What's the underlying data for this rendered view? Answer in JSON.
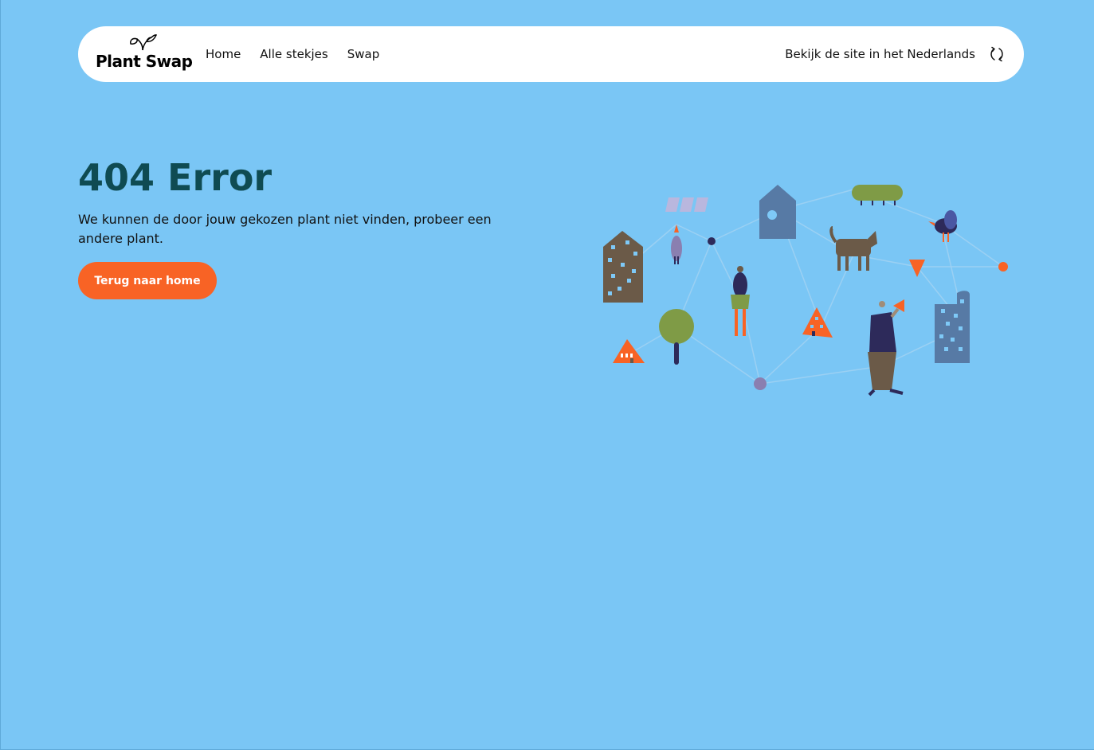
{
  "nav": {
    "logo_text": "Plant Swap",
    "links": [
      "Home",
      "Alle stekjes",
      "Swap"
    ],
    "language_link": "Bekijk de site in het Nederlands"
  },
  "main": {
    "title": "404 Error",
    "message": "We kunnen de door jouw gekozen plant niet vinden, probeer een andere plant.",
    "button_label": "Terug naar home"
  },
  "colors": {
    "background": "#7ac6f5",
    "title": "#0f4b52",
    "button": "#f86325"
  }
}
